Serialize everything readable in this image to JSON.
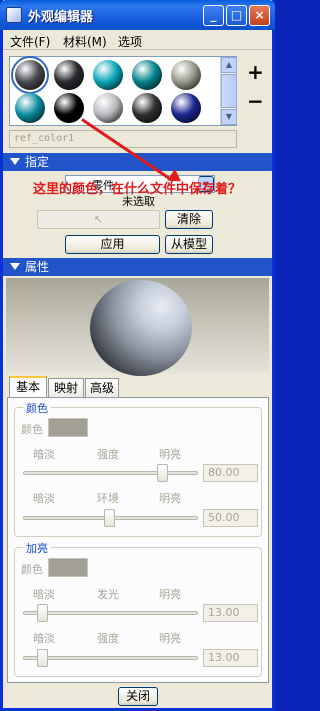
{
  "window": {
    "title": "外观编辑器"
  },
  "menu": [
    {
      "label": "文件(F)"
    },
    {
      "label": "材料(M)"
    },
    {
      "label": "选项"
    }
  ],
  "swatches": {
    "colors": [
      "#4a4d52",
      "#2a2c30",
      "#0aa7b8",
      "#07858f",
      "#9b9a8c",
      "#0a8da0",
      "#000000",
      "#b7b9bd",
      "#2f3033",
      "#1b2890"
    ],
    "add_icon": "plus-icon",
    "remove_icon": "minus-icon",
    "ref_field": "ref_color1"
  },
  "section_assign": {
    "header": "指定",
    "dropdown_value": "零件",
    "state_text": "未选取",
    "select_placeholder": "",
    "clear_button": "清除",
    "apply_button": "应用",
    "from_model_button": "从模型"
  },
  "annotation": {
    "text": "这里的颜色，在什么文件中保存着？",
    "color": "#e11b1b"
  },
  "section_properties": {
    "header": "属性"
  },
  "tabs": [
    {
      "label": "基本"
    },
    {
      "label": "映射"
    },
    {
      "label": "高级"
    }
  ],
  "color_group": {
    "title": "颜色",
    "color_label": "颜色",
    "swatch_color": "#a19e93",
    "row1": {
      "left": "暗淡",
      "mid": "强度",
      "right": "明亮",
      "value": "80.00"
    },
    "row2": {
      "left": "暗淡",
      "mid": "环境",
      "right": "明亮",
      "value": "50.00"
    }
  },
  "highlight_group": {
    "title": "加亮",
    "color_label": "颜色",
    "swatch_color": "#a19e93",
    "row1": {
      "left": "暗淡",
      "mid": "发光",
      "right": "明亮",
      "value": "13.00"
    },
    "row2": {
      "left": "暗淡",
      "mid": "强度",
      "right": "明亮",
      "value": "13.00"
    }
  },
  "close_button": "关闭"
}
